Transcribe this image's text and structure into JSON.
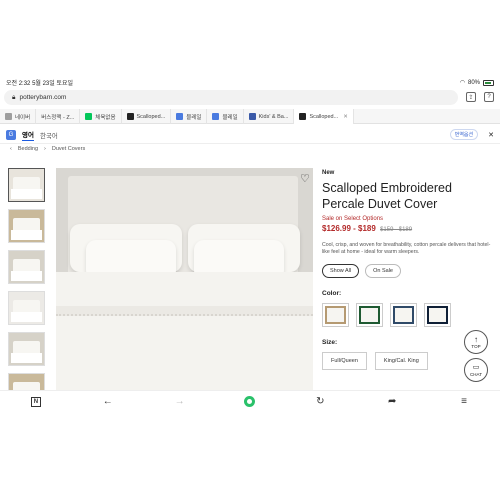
{
  "status": {
    "time": "오전 2:32",
    "date": "5월 23일 토요일",
    "battery": "80%"
  },
  "browser": {
    "url": "potterybarn.com",
    "tabs": [
      {
        "label": "네이버",
        "color": "#2db400"
      },
      {
        "label": "버스정맥 - Z...",
        "color": "#9e9e9e"
      },
      {
        "label": "체육없음",
        "color": "#03c75a"
      },
      {
        "label": "Scalloped...",
        "color": "#222222"
      },
      {
        "label": "블레일",
        "color": "#4a7be0"
      },
      {
        "label": "블레일",
        "color": "#4a7be0"
      },
      {
        "label": "Kids' & Ba...",
        "color": "#3b5aa8"
      },
      {
        "label": "Scalloped...",
        "color": "#222222"
      }
    ]
  },
  "translate": {
    "lang1": "영어",
    "lang2": "한국어",
    "options": "번역옵션"
  },
  "breadcrumb": {
    "item1": "Bedding",
    "item2": "Duvet Covers"
  },
  "product": {
    "badge": "New",
    "title": "Scalloped Embroidered Percale Duvet Cover",
    "sale_link": "Sale on Select Options",
    "price": "$126.99 - $189",
    "orig_price": "$159 - $189",
    "description": "Cool, crisp, and woven for breathability, cotton percale delivers that hotel-like feel at home - ideal for warm sleepers.",
    "toggle": {
      "show_all": "Show All",
      "on_sale": "On Sale"
    },
    "color_label": "Color:",
    "swatches": [
      {
        "name": "Tan",
        "color": "#b59a72"
      },
      {
        "name": "Green",
        "color": "#1f5a32"
      },
      {
        "name": "Blue",
        "color": "#2f4a68"
      },
      {
        "name": "Navy",
        "color": "#0f1f36"
      }
    ],
    "size_label": "Size:",
    "sizes": [
      "Full/Queen",
      "King/Cal. King"
    ]
  },
  "floating": {
    "top": "TOP",
    "chat": "CHAT"
  }
}
